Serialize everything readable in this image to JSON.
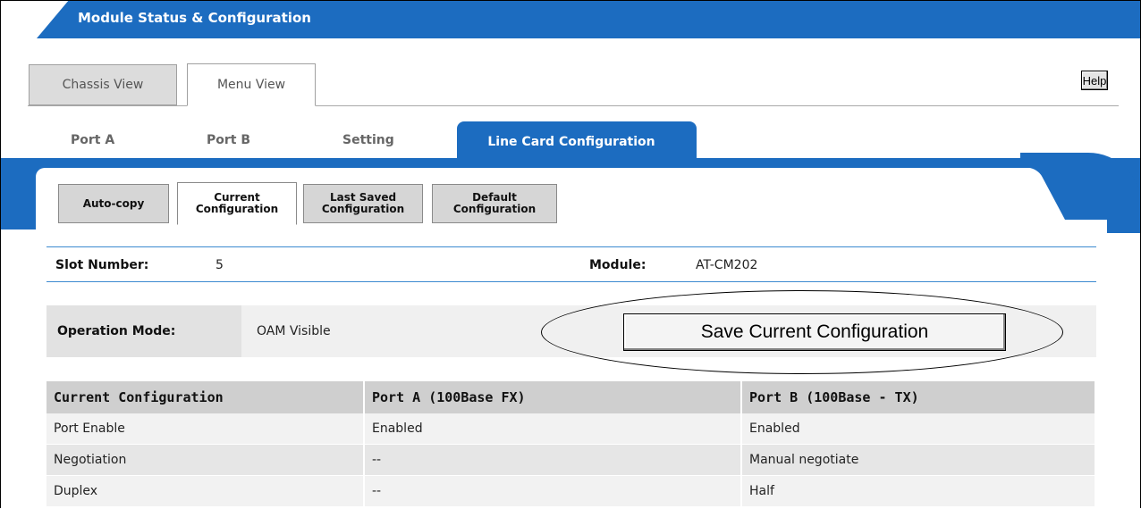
{
  "header": {
    "title": "Module Status & Configuration"
  },
  "view_tabs": [
    {
      "label": "Chassis View"
    },
    {
      "label": "Menu View"
    }
  ],
  "help_label": "Help",
  "section_tabs": [
    {
      "label": "Port A"
    },
    {
      "label": "Port B"
    },
    {
      "label": "Setting"
    },
    {
      "label": "Line Card Configuration",
      "active": true
    }
  ],
  "sub_tabs": [
    {
      "line1": "Auto-copy",
      "line2": ""
    },
    {
      "line1": "Current",
      "line2": "Configuration",
      "active": true
    },
    {
      "line1": "Last Saved",
      "line2": "Configuration"
    },
    {
      "line1": "Default",
      "line2": "Configuration"
    }
  ],
  "slot": {
    "label": "Slot Number:",
    "value": "5"
  },
  "module": {
    "label": "Module:",
    "value": "AT-CM202"
  },
  "operation_mode": {
    "label": "Operation Mode:",
    "value": "OAM Visible"
  },
  "save_button": {
    "label": "Save Current Configuration"
  },
  "table": {
    "headers": [
      "Current Configuration",
      "Port A (100Base FX)",
      "Port B (100Base - TX)"
    ],
    "rows": [
      [
        "Port Enable",
        "Enabled",
        "Enabled"
      ],
      [
        "Negotiation",
        "--",
        "Manual negotiate"
      ],
      [
        "Duplex",
        "--",
        "Half"
      ]
    ]
  },
  "colors": {
    "accent": "#1c6cc0",
    "table_header": "#cfcfcf"
  }
}
